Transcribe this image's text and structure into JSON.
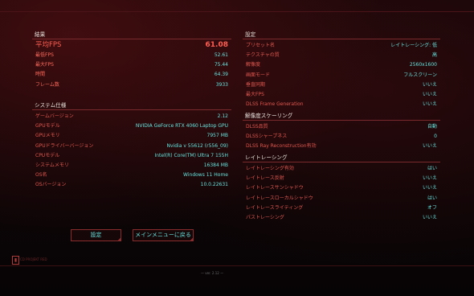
{
  "results": {
    "title": "結果",
    "avg_fps": {
      "label": "平均FPS",
      "value": "61.08"
    },
    "rows": [
      {
        "label": "最低FPS",
        "value": "52.61"
      },
      {
        "label": "最大FPS",
        "value": "75.44"
      },
      {
        "label": "時間",
        "value": "64.39"
      },
      {
        "label": "フレーム数",
        "value": "3933"
      }
    ]
  },
  "system": {
    "title": "システム仕様",
    "rows": [
      {
        "label": "ゲームバージョン",
        "value": "2.12"
      },
      {
        "label": "GPUモデル",
        "value": "NVIDIA GeForce RTX 4060 Laptop GPU"
      },
      {
        "label": "GPUメモリ",
        "value": "7957 MB"
      },
      {
        "label": "GPUドライバーバージョン",
        "value": "Nvidia v 55612 (r556_09)"
      },
      {
        "label": "CPUモデル",
        "value": "Intel(R) Core(TM) Ultra 7 155H"
      },
      {
        "label": "システムメモリ",
        "value": "16384 MB"
      },
      {
        "label": "OS名",
        "value": "Windows 11 Home"
      },
      {
        "label": "OSバージョン",
        "value": "10.0.22631"
      }
    ]
  },
  "settings": {
    "title": "設定",
    "rows": [
      {
        "label": "プリセット名",
        "value": "レイトレーシング: 低"
      },
      {
        "label": "テクスチャの質",
        "value": "高"
      },
      {
        "label": "解像度",
        "value": "2560x1600"
      },
      {
        "label": "画面モード",
        "value": "フルスクリーン"
      },
      {
        "label": "垂直同期",
        "value": "いいえ"
      },
      {
        "label": "最大FPS",
        "value": "いいえ"
      },
      {
        "label": "DLSS Frame Generation",
        "value": "いいえ"
      }
    ]
  },
  "upscaling": {
    "title": "解像度スケーリング",
    "rows": [
      {
        "label": "DLSS品質",
        "value": "自動"
      },
      {
        "label": "DLSSシャープネス",
        "value": "0"
      },
      {
        "label": "DLSS Ray Reconstruction有効",
        "value": "いいえ"
      }
    ]
  },
  "raytracing": {
    "title": "レイトレーシング",
    "rows": [
      {
        "label": "レイトレーシング有効",
        "value": "はい"
      },
      {
        "label": "レイトレース反射",
        "value": "いいえ"
      },
      {
        "label": "レイトレースサンシャドウ",
        "value": "いいえ"
      },
      {
        "label": "レイトレースローカルシャドウ",
        "value": "はい"
      },
      {
        "label": "レイトレースライティング",
        "value": "オフ"
      },
      {
        "label": "パストレーシング",
        "value": "いいえ"
      }
    ]
  },
  "buttons": {
    "settings": "設定",
    "main_menu": "メインメニューに戻る"
  },
  "footer": {
    "legal": "CD PROJEKT RED",
    "center": "— ver. 2.12 —"
  },
  "colors": {
    "label": "#e0574f",
    "value": "#66e3de",
    "accent": "#ff5e52",
    "rule": "#7a2a2c"
  }
}
